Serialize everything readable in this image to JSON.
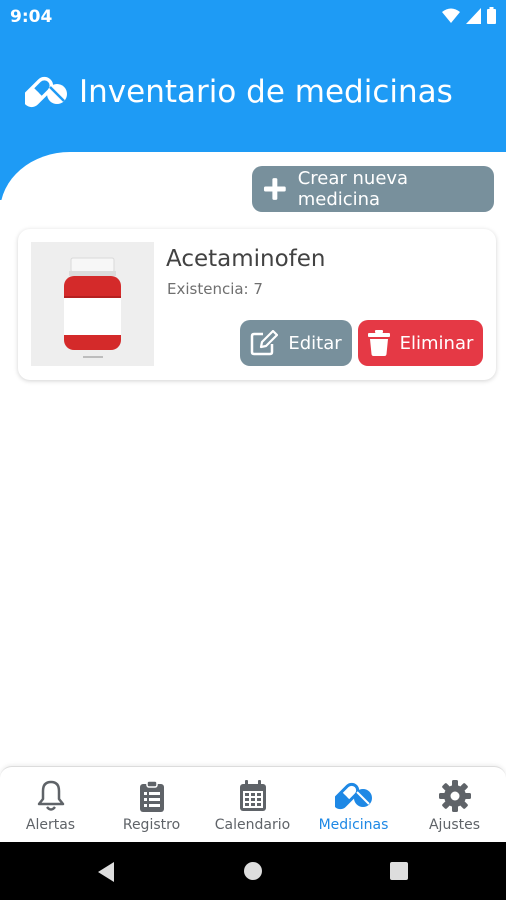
{
  "status_bar": {
    "time": "9:04"
  },
  "header": {
    "title": "Inventario de medicinas",
    "icon": "pills-icon"
  },
  "actions": {
    "create_label": "Crear nueva medicina"
  },
  "medicines": [
    {
      "name": "Acetaminofen",
      "stock_text": "Existencia: 7",
      "edit_label": "Editar",
      "delete_label": "Eliminar"
    }
  ],
  "bottom_nav": {
    "items": [
      {
        "label": "Alertas",
        "icon": "bell-icon"
      },
      {
        "label": "Registro",
        "icon": "clipboard-icon"
      },
      {
        "label": "Calendario",
        "icon": "calendar-icon"
      },
      {
        "label": "Medicinas",
        "icon": "pills-icon",
        "active": true
      },
      {
        "label": "Ajustes",
        "icon": "gear-icon"
      }
    ]
  },
  "colors": {
    "primary": "#1e9bf5",
    "secondary": "#78909c",
    "danger": "#e53945",
    "active_nav": "#1e88e5"
  }
}
